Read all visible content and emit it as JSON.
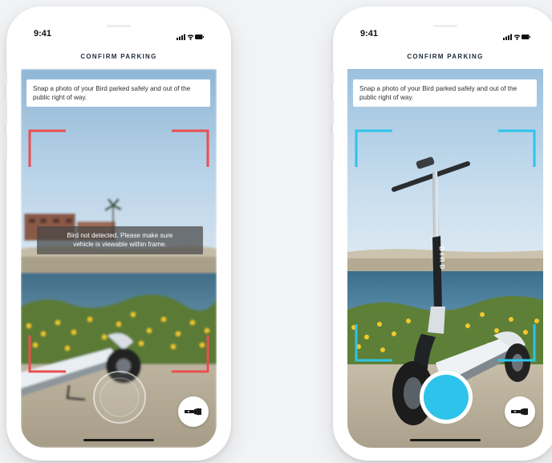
{
  "screens": [
    {
      "id": "left",
      "status_time": "9:41",
      "title": "CONFIRM PARKING",
      "instruction": "Snap a photo of your Bird parked safely and out of the public right of way.",
      "alert_line1": "Bird not detected. Please make sure",
      "alert_line2": "vehicle is viewable within frame.",
      "frame_state": "not-detected",
      "capture_state": "disabled"
    },
    {
      "id": "right",
      "status_time": "9:41",
      "title": "CONFIRM PARKING",
      "instruction": "Snap a photo of your Bird parked safely and out of the public right of way.",
      "stem_label": "BIRD",
      "frame_state": "detected",
      "capture_state": "enabled"
    }
  ],
  "colors": {
    "frame_error": "#ea4e50",
    "frame_ok": "#2ec3ea",
    "capture_button": "#2ec3ea",
    "title_text": "#1e2a38"
  },
  "icons": {
    "flashlight": "flashlight-icon",
    "signal": "signal-icon",
    "wifi": "wifi-icon",
    "battery": "battery-icon"
  }
}
